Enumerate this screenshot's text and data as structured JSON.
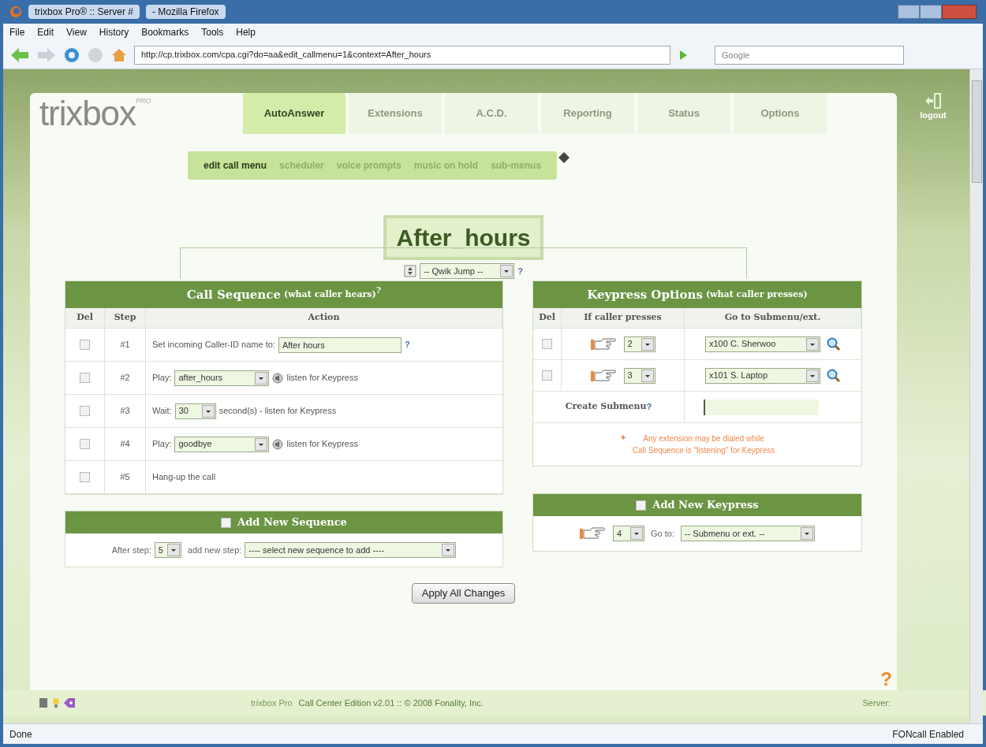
{
  "window": {
    "title": "trixbox Pro® :: Server #",
    "title_suffix": "- Mozilla Firefox"
  },
  "menu": [
    "File",
    "Edit",
    "View",
    "History",
    "Bookmarks",
    "Tools",
    "Help"
  ],
  "address": {
    "url": "http://cp.trixbox.com/cpa.cgi?do=aa&edit_callmenu=1&context=After_hours"
  },
  "search": {
    "placeholder": "Google"
  },
  "logo": {
    "text": "trixbox",
    "sup": "PRO"
  },
  "tabs": [
    {
      "label": "AutoAnswer",
      "selected": true
    },
    {
      "label": "Extensions",
      "selected": false
    },
    {
      "label": "A.C.D.",
      "selected": false
    },
    {
      "label": "Reporting",
      "selected": false
    },
    {
      "label": "Status",
      "selected": false
    },
    {
      "label": "Options",
      "selected": false
    }
  ],
  "logout": "logout",
  "subtabs": [
    {
      "label": "edit call menu",
      "selected": true
    },
    {
      "label": "scheduler",
      "selected": false
    },
    {
      "label": "voice prompts",
      "selected": false
    },
    {
      "label": "music on hold",
      "selected": false
    },
    {
      "label": "sub-menus",
      "selected": false
    }
  ],
  "menu_title": "After_hours",
  "quick_jump": {
    "value": "-- Qwik Jump --",
    "help": "?"
  },
  "call_sequence": {
    "title": "Call Sequence",
    "subtitle": "(what caller hears)",
    "help": "?",
    "columns": [
      "Del",
      "Step",
      "Action"
    ],
    "rows": [
      {
        "kind": "input",
        "checked": false,
        "step": "#1",
        "label": "Set incoming Caller-ID name to:",
        "caller_id": "After hours",
        "help": "?"
      },
      {
        "kind": "play",
        "checked": false,
        "step": "#2",
        "label": "Play:",
        "value": "after_hours",
        "suffix": "listen for Keypress"
      },
      {
        "kind": "wait",
        "checked": false,
        "step": "#3",
        "label": "Wait:",
        "value": "30",
        "suffix": "second(s) - listen for Keypress"
      },
      {
        "kind": "play",
        "checked": false,
        "step": "#4",
        "label": "Play:",
        "value": "goodbye",
        "suffix": "listen for Keypress"
      },
      {
        "kind": "text",
        "checked": false,
        "step": "#5",
        "label": "Hang-up the call"
      }
    ]
  },
  "keypress": {
    "title": "Keypress Options",
    "subtitle": "(what caller presses)",
    "columns": [
      "Del",
      "If caller presses",
      "Go to Submenu/ext."
    ],
    "rows": [
      {
        "checked": false,
        "key": "2",
        "target": "x100 C. Sherwoo"
      },
      {
        "checked": false,
        "key": "3",
        "target": "x101 S. Laptop"
      }
    ],
    "create_label": "Create Submenu",
    "create_help": "?",
    "note": [
      "Any extension may be dialed while",
      "Call Sequence is \"listening\" for Keypress"
    ]
  },
  "add_sequence": {
    "title": "Add New Sequence",
    "checked": false,
    "after_label": "After step:",
    "step": "5",
    "add_label": "add new step:",
    "select": "---- select new sequence to add ----"
  },
  "add_keypress": {
    "title": "Add New Keypress",
    "checked": false,
    "key": "4",
    "goto_label": "Go to:",
    "select": "-- Submenu or ext. --"
  },
  "apply": "Apply All Changes",
  "help_corner": "?",
  "footer": {
    "product": "trixbox Pro",
    "edition": "Call Center Edition v2.01 :: © 2008 Fonality, Inc.",
    "server": "Server:"
  },
  "status": {
    "text": "Done",
    "foncall": "FONcall Enabled"
  }
}
